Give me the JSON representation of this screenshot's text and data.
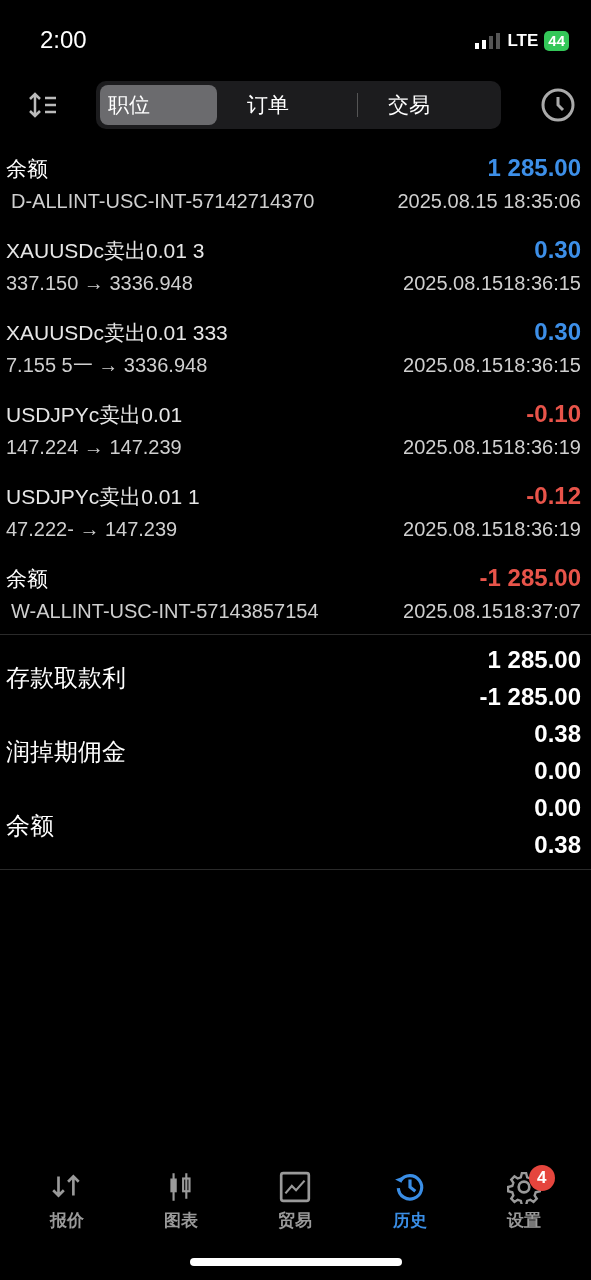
{
  "status_bar": {
    "time": "2:00",
    "network": "LTE",
    "battery": "44"
  },
  "toolbar": {
    "tabs": [
      {
        "label": "职位",
        "selected": true
      },
      {
        "label": "订单",
        "selected": false
      },
      {
        "label": "交易",
        "selected": false
      }
    ]
  },
  "history": [
    {
      "kind": "balance",
      "title": "余额",
      "detail": "D-ALLINT-USC-INT-57142714370",
      "amount": "1 285.00",
      "color": "#3d8fe8",
      "time": "2025.08.15 18:35:06"
    },
    {
      "kind": "trade",
      "title": "XAUUSDc卖出0.01 3",
      "detail": "337.150 → 3336.948",
      "amount": "0.30",
      "color": "#3d8fe8",
      "time": "2025.08.1518:36:15"
    },
    {
      "kind": "trade",
      "title": "XAUUSDc卖出0.01 333",
      "detail": "7.155 5一 → 3336.948",
      "amount": "0.30",
      "color": "#3d8fe8",
      "time": "2025.08.1518:36:15"
    },
    {
      "kind": "trade",
      "title": "USDJPYc卖出0.01",
      "detail": "147.224 → 147.239",
      "amount": "-0.10",
      "color": "#e8544a",
      "time": "2025.08.1518:36:19"
    },
    {
      "kind": "trade",
      "title": "USDJPYc卖出0.01 1",
      "detail": "47.222- → 147.239",
      "amount": "-0.12",
      "color": "#e8544a",
      "time": "2025.08.1518:36:19"
    },
    {
      "kind": "balance",
      "title": "余额",
      "detail": "W-ALLINT-USC-INT-57143857154",
      "amount": "-1 285.00",
      "color": "#e8544a",
      "time": "2025.08.1518:37:07"
    }
  ],
  "summary": [
    {
      "label": "存款取款利",
      "values": [
        "1 285.00",
        "-1 285.00"
      ]
    },
    {
      "label": "润掉期佣金",
      "values": [
        "0.38",
        "0.00"
      ]
    },
    {
      "label": "余额",
      "values": [
        "0.00",
        "0.38"
      ]
    }
  ],
  "bottom_nav": [
    {
      "label": "报价",
      "selected": false
    },
    {
      "label": "图表",
      "selected": false
    },
    {
      "label": "贸易",
      "selected": false
    },
    {
      "label": "历史",
      "selected": true
    },
    {
      "label": "设置",
      "selected": false,
      "badge": "4"
    }
  ]
}
